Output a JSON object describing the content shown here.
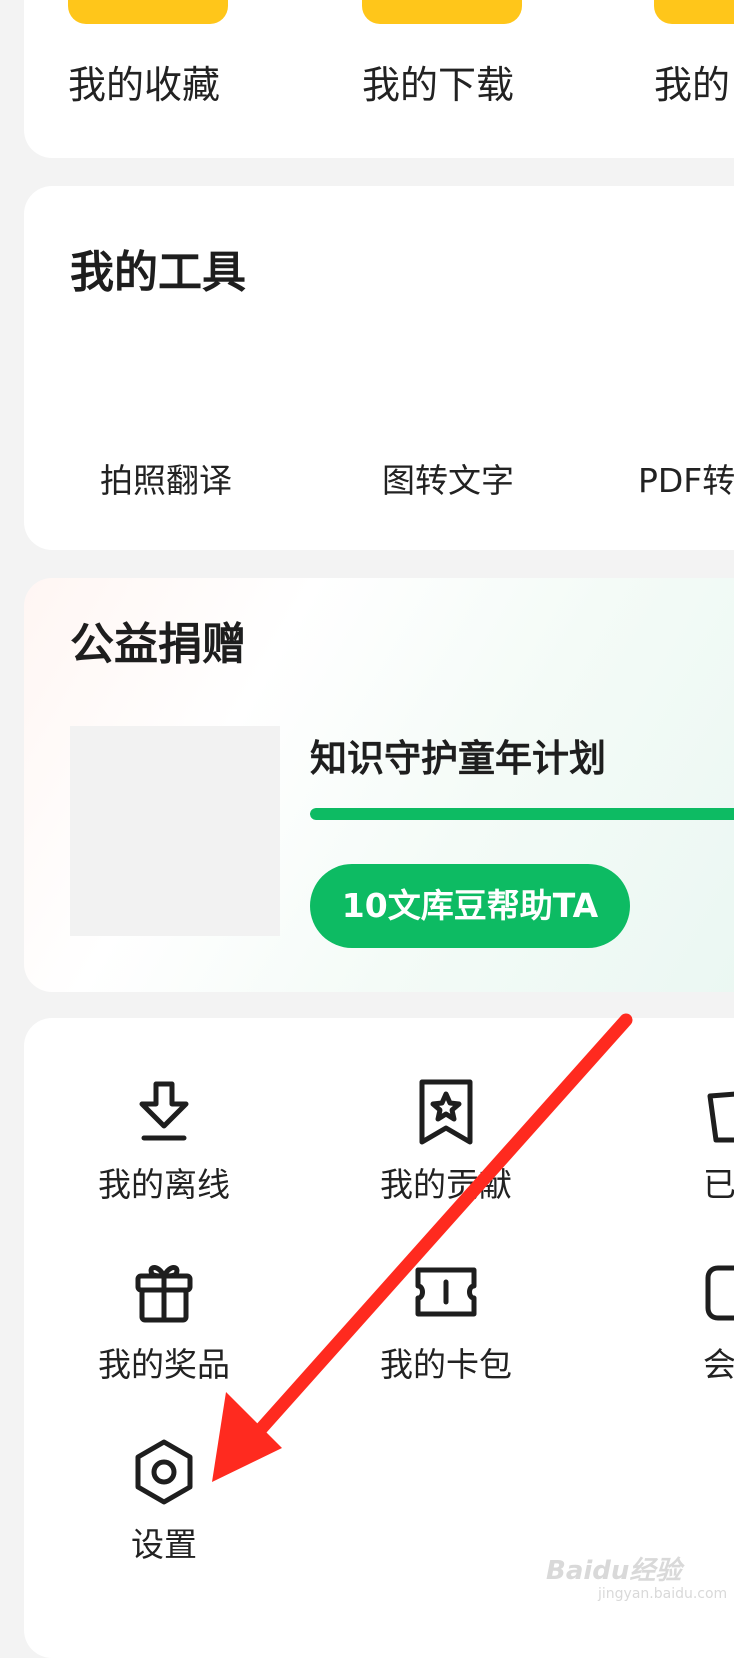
{
  "top_row": {
    "items": [
      {
        "label": "我的收藏"
      },
      {
        "label": "我的下载"
      },
      {
        "label": "我的"
      }
    ]
  },
  "tools": {
    "title": "我的工具",
    "items": [
      {
        "label": "拍照翻译"
      },
      {
        "label": "图转文字"
      },
      {
        "label": "PDF转"
      }
    ]
  },
  "charity": {
    "title": "公益捐赠",
    "project_title": "知识守护童年计划",
    "progress": 1.0,
    "button_label": "10文库豆帮助TA"
  },
  "menu": {
    "items": [
      {
        "label": "我的离线",
        "icon": "offline-download-icon"
      },
      {
        "label": "我的贡献",
        "icon": "contribution-star-icon"
      },
      {
        "label": "已购",
        "icon": "purchased-bag-icon"
      },
      {
        "label": "我的奖品",
        "icon": "gift-icon"
      },
      {
        "label": "我的卡包",
        "icon": "ticket-icon"
      },
      {
        "label": "会员",
        "icon": "membership-icon"
      },
      {
        "label": "设置",
        "icon": "settings-hexagon-icon"
      }
    ]
  },
  "annotation": {
    "color": "#ff2a1f"
  },
  "watermark": {
    "text": "Baidu经验",
    "subtext": "jingyan.baidu.com"
  },
  "colors": {
    "accent_green": "#0dbb63",
    "accent_yellow": "#ffc61a"
  }
}
